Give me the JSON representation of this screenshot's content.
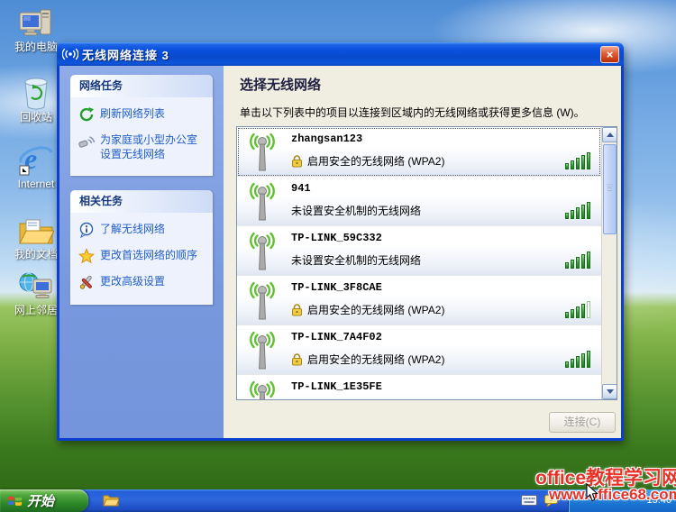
{
  "desktop": {
    "icons": [
      {
        "label": "我的电脑",
        "icon": "my-computer-icon"
      },
      {
        "label": "回收站",
        "icon": "recycle-bin-icon"
      },
      {
        "label": "Internet",
        "icon": "internet-explorer-icon"
      },
      {
        "label": "我的文档",
        "icon": "my-documents-icon"
      },
      {
        "label": "网上邻居",
        "icon": "network-places-icon"
      }
    ]
  },
  "window": {
    "title": "无线网络连接 3",
    "close_label": "×",
    "sidebar": {
      "cards": [
        {
          "title": "网络任务",
          "items": [
            {
              "label": "刷新网络列表",
              "icon": "refresh-icon"
            },
            {
              "label": "为家庭或小型办公室设置无线网络",
              "icon": "wireless-setup-icon"
            }
          ]
        },
        {
          "title": "相关任务",
          "items": [
            {
              "label": "了解无线网络",
              "icon": "info-icon"
            },
            {
              "label": "更改首选网络的顺序",
              "icon": "star-icon"
            },
            {
              "label": "更改高级设置",
              "icon": "advanced-settings-icon"
            }
          ]
        }
      ]
    },
    "main": {
      "heading": "选择无线网络",
      "instruction": "单击以下列表中的项目以连接到区域内的无线网络或获得更多信息 (W)。",
      "connect_button": "连接(C)",
      "networks": [
        {
          "name": "zhangsan123",
          "status": "启用安全的无线网络 (WPA2)",
          "secured": true,
          "signal": 5,
          "selected": true
        },
        {
          "name": "941",
          "status": "未设置安全机制的无线网络",
          "secured": false,
          "signal": 5,
          "selected": false
        },
        {
          "name": "TP-LINK_59C332",
          "status": "未设置安全机制的无线网络",
          "secured": false,
          "signal": 5,
          "selected": false
        },
        {
          "name": "TP-LINK_3F8CAE",
          "status": "启用安全的无线网络 (WPA2)",
          "secured": true,
          "signal": 4,
          "selected": false
        },
        {
          "name": "TP-LINK_7A4F02",
          "status": "启用安全的无线网络 (WPA2)",
          "secured": true,
          "signal": 5,
          "selected": false
        },
        {
          "name": "TP-LINK_1E35FE",
          "status": "",
          "secured": false,
          "signal": null,
          "selected": false
        }
      ]
    }
  },
  "taskbar": {
    "start_label": "开始",
    "clock": "15:46"
  },
  "watermark": {
    "line1": "office教程学习网",
    "line2": "www.office68.com"
  },
  "colors": {
    "titlebar_blue": "#0A50DE",
    "window_border_blue": "#0C3FD0",
    "taskbar_blue": "#2E66DC",
    "start_green": "#2F8A2A",
    "task_link_blue": "#215DC6",
    "signal_green": "#2F8F2F",
    "watermark_red": "#E63228"
  }
}
